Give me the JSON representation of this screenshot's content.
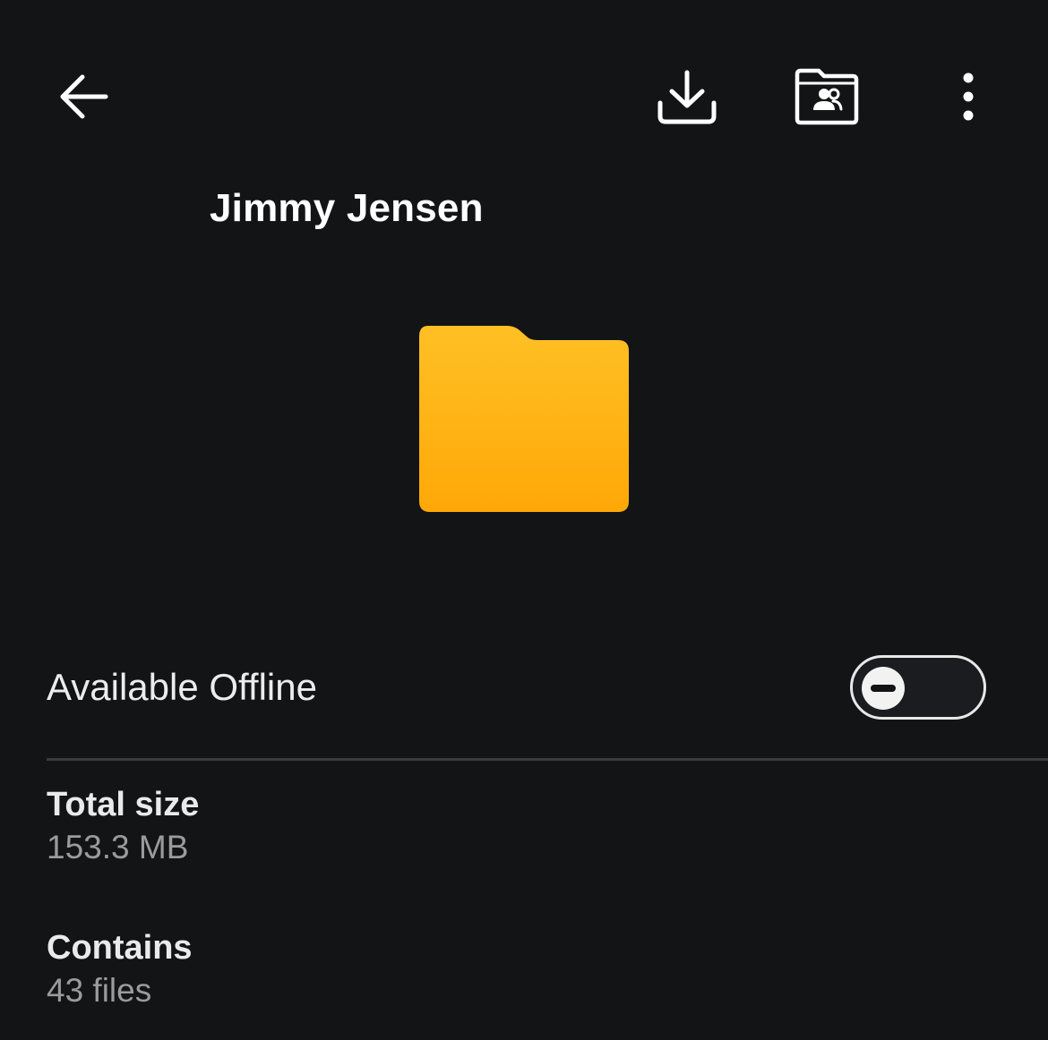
{
  "header": {
    "back_icon": "arrow-left-icon",
    "download_icon": "download-icon",
    "shared_folder_icon": "shared-folder-icon",
    "more_icon": "more-vertical-icon"
  },
  "folder": {
    "name": "Jimmy Jensen",
    "icon": "folder-icon",
    "icon_color": "#FFB612"
  },
  "offline": {
    "label": "Available Offline",
    "enabled": false
  },
  "details": {
    "total_size": {
      "label": "Total size",
      "value": "153.3 MB"
    },
    "contains": {
      "label": "Contains",
      "value": "43 files"
    }
  },
  "colors": {
    "background": "#131416",
    "text_primary": "#FFFFFF",
    "text_secondary": "#9A9B9E",
    "divider": "#3A3B3E"
  }
}
